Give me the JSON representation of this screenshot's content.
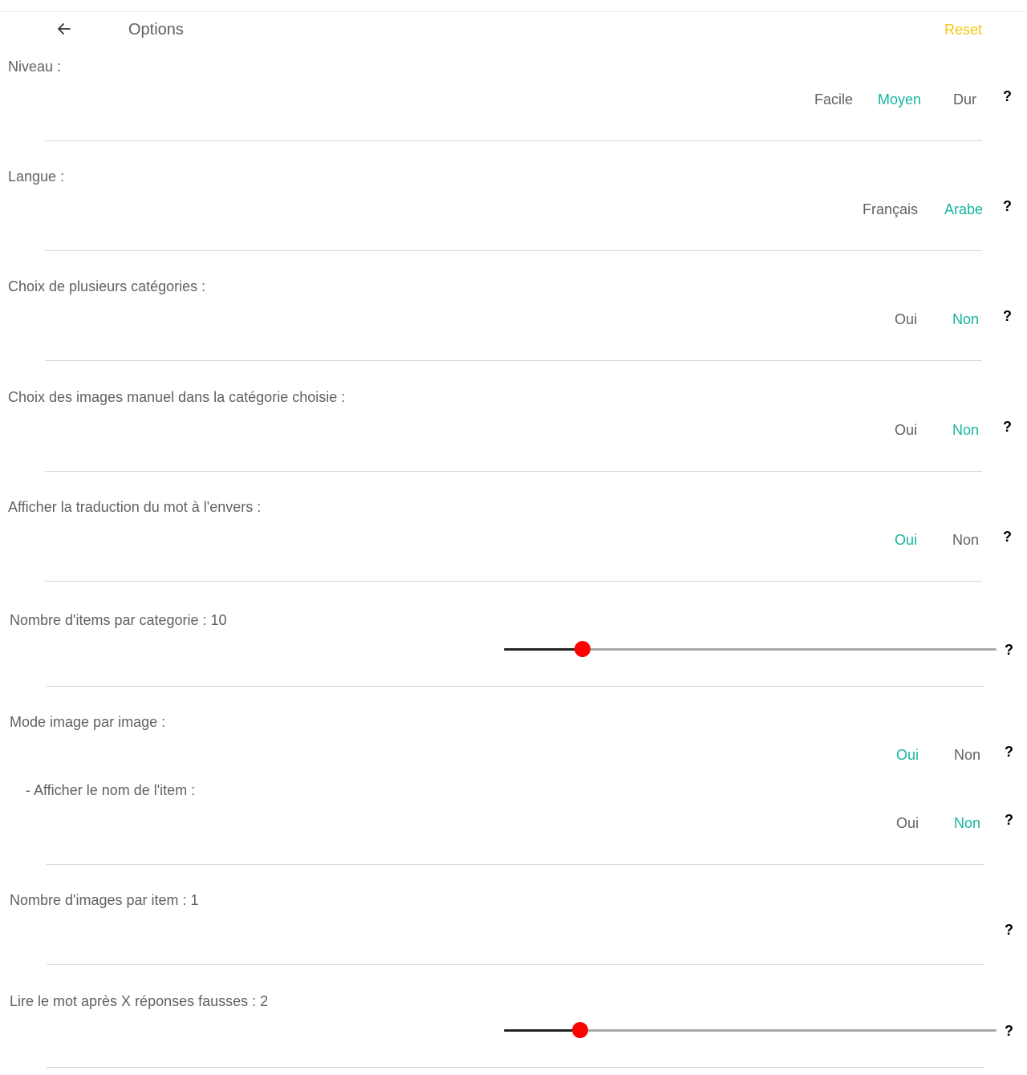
{
  "header": {
    "back_icon": "arrow-left-icon",
    "title": "Options",
    "reset_label": "Reset",
    "reset_color": "#f2c80f"
  },
  "colors": {
    "selected": "#14b5a0",
    "text": "#616161",
    "slider_thumb": "#ff0000"
  },
  "help_label": "?",
  "settings": {
    "niveau": {
      "label": "Niveau :",
      "options": [
        "Facile",
        "Moyen",
        "Dur"
      ],
      "selected": "Moyen"
    },
    "langue": {
      "label": "Langue :",
      "options": [
        "Français",
        "Arabe"
      ],
      "selected": "Arabe"
    },
    "categories": {
      "label": "Choix de plusieurs catégories :",
      "options": [
        "Oui",
        "Non"
      ],
      "selected": "Non"
    },
    "images_manuel": {
      "label": "Choix des images manuel dans la catégorie choisie :",
      "options": [
        "Oui",
        "Non"
      ],
      "selected": "Non"
    },
    "traduction": {
      "label": "Afficher la traduction du mot à l'envers :",
      "options": [
        "Oui",
        "Non"
      ],
      "selected": "Oui"
    },
    "items_par_categorie": {
      "label": "Nombre d'items par categorie : 10",
      "value": 10,
      "fill_fraction": 0.16
    },
    "mode_image": {
      "label": "Mode image par image :",
      "options": [
        "Oui",
        "Non"
      ],
      "selected": "Oui"
    },
    "nom_item": {
      "label": "- Afficher le nom de l'item :",
      "options": [
        "Oui",
        "Non"
      ],
      "selected": "Non"
    },
    "images_par_item": {
      "label": "Nombre d'images par item : 1",
      "value": 1
    },
    "lire_mot": {
      "label": "Lire le mot après X réponses fausses : 2",
      "value": 2,
      "fill_fraction": 0.155
    }
  }
}
